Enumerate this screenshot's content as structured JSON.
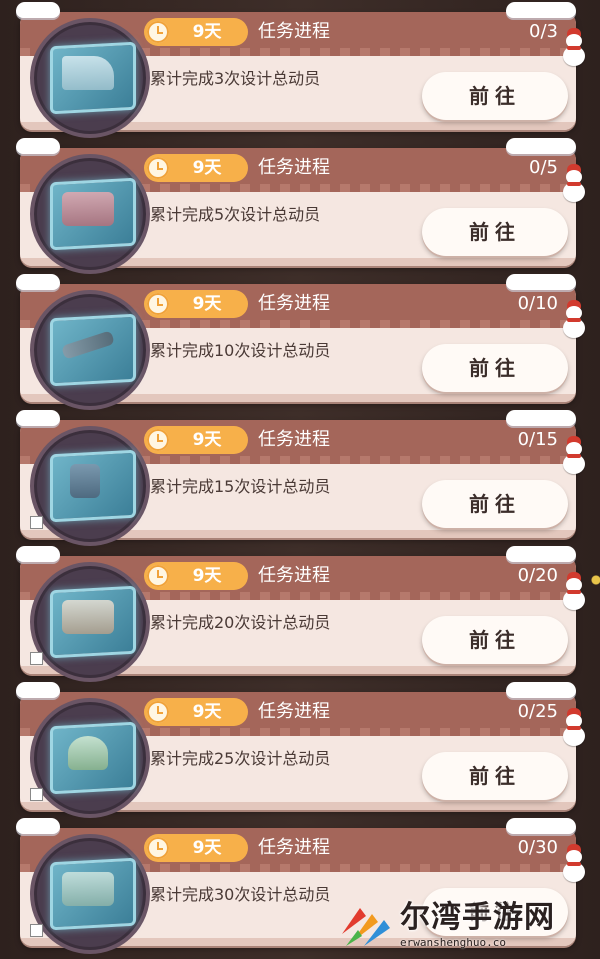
{
  "tasks": [
    {
      "days": "9天",
      "progress_label": "任务进程",
      "count": "0/3",
      "description": "累计完成3次设计总动员",
      "button": "前往",
      "has_checkbox": false
    },
    {
      "days": "9天",
      "progress_label": "任务进程",
      "count": "0/5",
      "description": "累计完成5次设计总动员",
      "button": "前往",
      "has_checkbox": false
    },
    {
      "days": "9天",
      "progress_label": "任务进程",
      "count": "0/10",
      "description": "累计完成10次设计总动员",
      "button": "前往",
      "has_checkbox": false
    },
    {
      "days": "9天",
      "progress_label": "任务进程",
      "count": "0/15",
      "description": "累计完成15次设计总动员",
      "button": "前往",
      "has_checkbox": true
    },
    {
      "days": "9天",
      "progress_label": "任务进程",
      "count": "0/20",
      "description": "累计完成20次设计总动员",
      "button": "前往",
      "has_checkbox": true
    },
    {
      "days": "9天",
      "progress_label": "任务进程",
      "count": "0/25",
      "description": "累计完成25次设计总动员",
      "button": "前往",
      "has_checkbox": true
    },
    {
      "days": "9天",
      "progress_label": "任务进程",
      "count": "0/30",
      "description": "累计完成30次设计总动员",
      "button": "前往",
      "has_checkbox": true
    }
  ],
  "watermark": {
    "title": "尔湾手游网",
    "subtitle": "erwanshenghuo.co"
  },
  "colors": {
    "header": "#a4665a",
    "card": "#f5e7e1",
    "timer_badge": "#f7b04a",
    "button": "#fffaf6"
  }
}
